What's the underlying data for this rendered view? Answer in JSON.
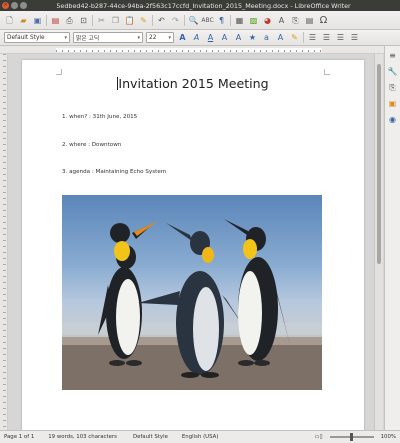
{
  "window": {
    "title": "5edbed42-b287-44ce-94ba-2f563c17ccfd_Invitation_2015_Meeting.docx - LibreOffice Writer"
  },
  "toolbar": {
    "paragraph_style": "Default Style",
    "font_name": "맑은 고딕",
    "font_size": "22"
  },
  "document": {
    "title": "Invitation 2015 Meeting",
    "items": [
      "1. when? : 31th June, 2015",
      "2. where : Downtown",
      "3. agenda : Maintaining Echo System"
    ]
  },
  "status": {
    "page": "Page 1 of 1",
    "words": "19 words, 103 characters",
    "style": "Default Style",
    "language": "English (USA)",
    "zoom": "100%",
    "zoom_level": 1.0
  },
  "colors": {
    "titlebar": "#3b3b37",
    "close": "#e05a2b"
  }
}
